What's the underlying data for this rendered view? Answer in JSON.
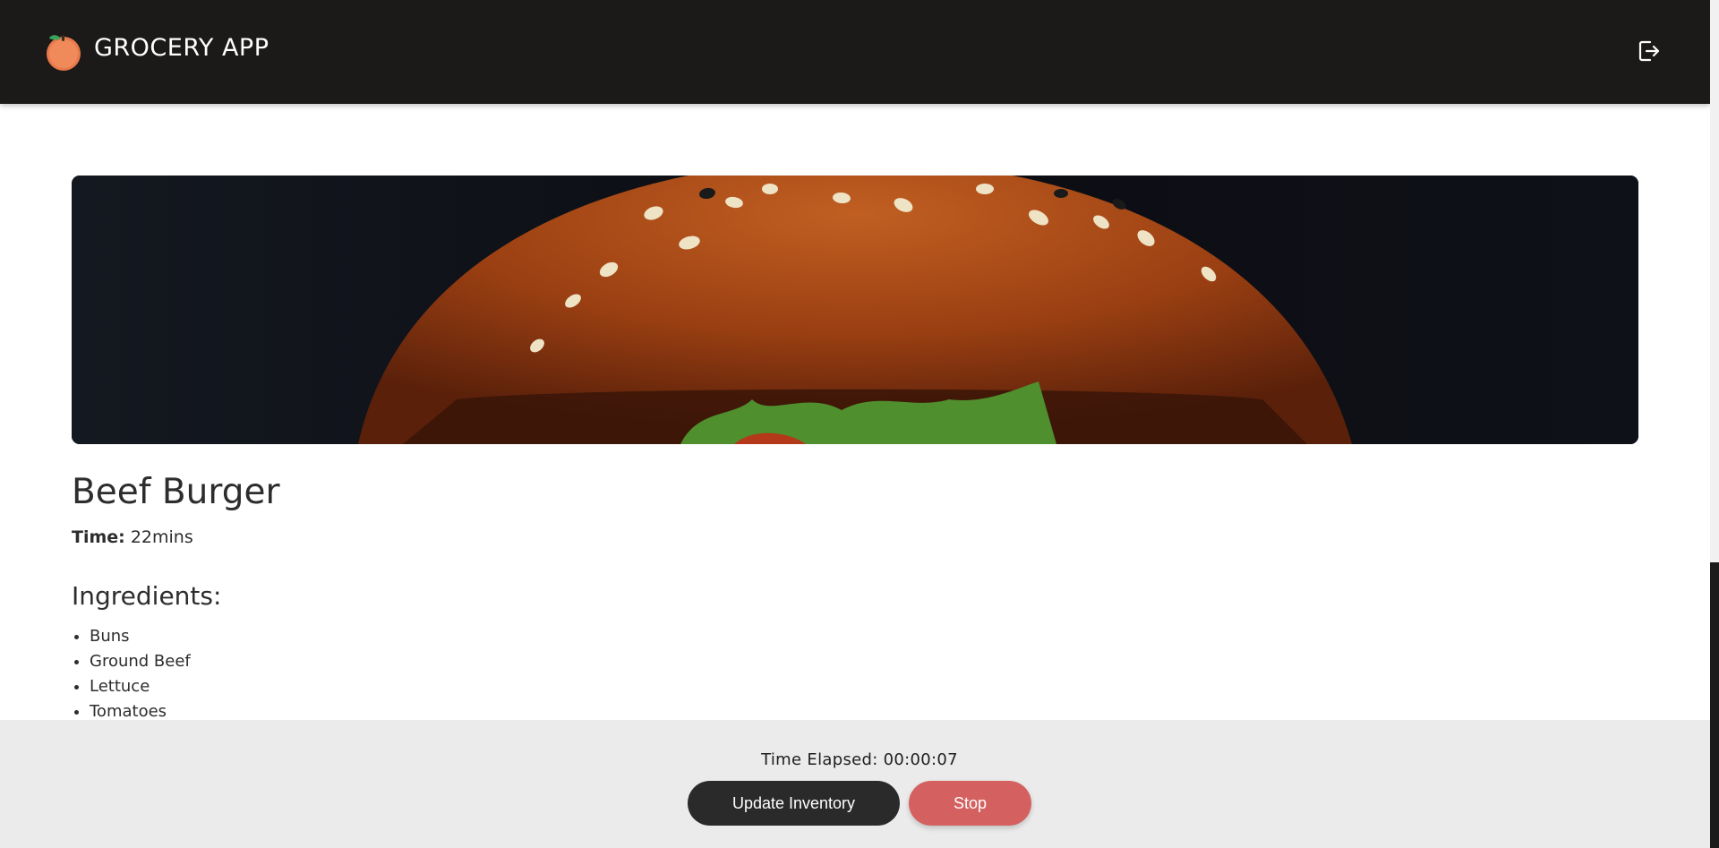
{
  "header": {
    "app_title": "GROCERY APP",
    "logo_icon": "orange-fruit-icon",
    "logout_icon": "logout-icon",
    "background": "#1c1a19"
  },
  "recipe": {
    "image_subject": "beef-burger-photo",
    "title": "Beef Burger",
    "time_label": "Time:",
    "time_value": "22mins",
    "ingredients_title": "Ingredients:",
    "ingredients": [
      "Buns",
      "Ground Beef",
      "Lettuce",
      "Tomatoes"
    ]
  },
  "footer": {
    "elapsed_text": "Time Elapsed: 00:00:07",
    "update_label": "Update Inventory",
    "stop_label": "Stop",
    "update_color": "#2a2a2a",
    "stop_color": "#d46060"
  }
}
